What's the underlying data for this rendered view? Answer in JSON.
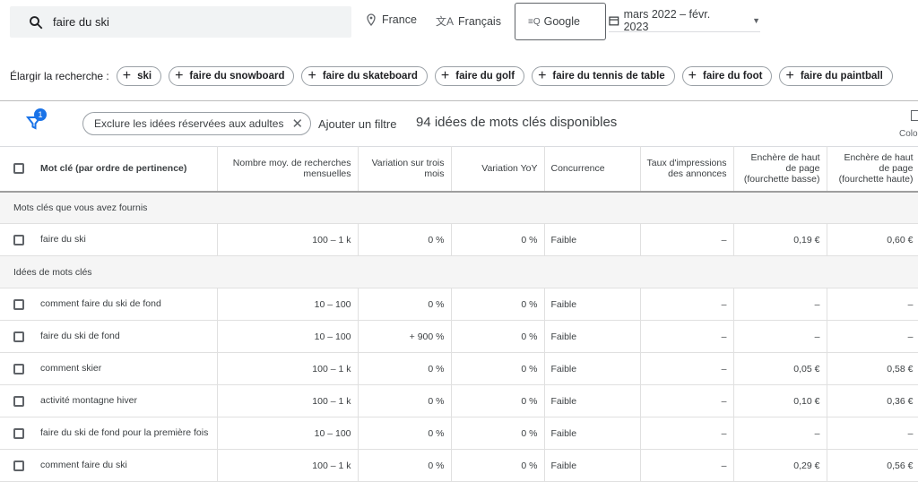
{
  "search": {
    "value": "faire du ski"
  },
  "location": "France",
  "language": "Français",
  "network": "Google",
  "date_range": "mars 2022 – févr. 2023",
  "refine": {
    "label": "Élargir la recherche :",
    "chips": [
      "ski",
      "faire du snowboard",
      "faire du skateboard",
      "faire du golf",
      "faire du tennis de table",
      "faire du foot",
      "faire du paintball"
    ]
  },
  "filterbar": {
    "badge": "1",
    "chip": "Exclure les idées réservées aux adultes",
    "add_filter": "Ajouter un filtre",
    "count": "94 idées de mots clés disponibles",
    "columns": "Colo"
  },
  "table": {
    "headers": {
      "keyword": "Mot clé (par ordre de pertinence)",
      "searches": "Nombre moy. de recherches mensuelles",
      "var3": "Variation sur trois mois",
      "yoy": "Variation YoY",
      "competition": "Concurrence",
      "impr": "Taux d'impressions des annonces",
      "bid_low": "Enchère de haut de page (fourchette basse)",
      "bid_high": "Enchère de haut de page (fourchette haute)"
    },
    "group1": "Mots clés que vous avez fournis",
    "group2": "Idées de mots clés",
    "rows": [
      {
        "kw": "faire du ski",
        "searches": "100 – 1 k",
        "var3": "0 %",
        "yoy": "0 %",
        "comp": "Faible",
        "impr": "–",
        "low": "0,19 €",
        "high": "0,60 €"
      },
      {
        "kw": "comment faire du ski de fond",
        "searches": "10 – 100",
        "var3": "0 %",
        "yoy": "0 %",
        "comp": "Faible",
        "impr": "–",
        "low": "–",
        "high": "–"
      },
      {
        "kw": "faire du ski de fond",
        "searches": "10 – 100",
        "var3": "+ 900 %",
        "yoy": "0 %",
        "comp": "Faible",
        "impr": "–",
        "low": "–",
        "high": "–"
      },
      {
        "kw": "comment skier",
        "searches": "100 – 1 k",
        "var3": "0 %",
        "yoy": "0 %",
        "comp": "Faible",
        "impr": "–",
        "low": "0,05 €",
        "high": "0,58 €"
      },
      {
        "kw": "activité montagne hiver",
        "searches": "100 – 1 k",
        "var3": "0 %",
        "yoy": "0 %",
        "comp": "Faible",
        "impr": "–",
        "low": "0,10 €",
        "high": "0,36 €"
      },
      {
        "kw": "faire du ski de fond pour la première fois",
        "searches": "10 – 100",
        "var3": "0 %",
        "yoy": "0 %",
        "comp": "Faible",
        "impr": "–",
        "low": "–",
        "high": "–"
      },
      {
        "kw": "comment faire du ski",
        "searches": "100 – 1 k",
        "var3": "0 %",
        "yoy": "0 %",
        "comp": "Faible",
        "impr": "–",
        "low": "0,29 €",
        "high": "0,56 €"
      }
    ]
  }
}
